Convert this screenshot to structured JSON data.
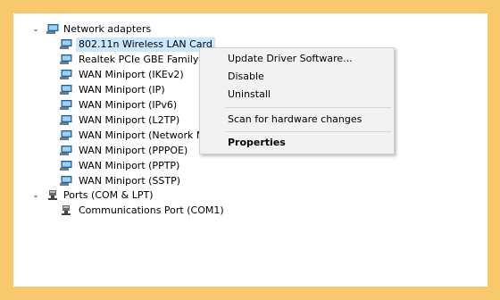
{
  "tree": {
    "category_network": {
      "label": "Network adapters",
      "icon": "network-adapter-icon",
      "expanded": true
    },
    "network_items": [
      {
        "label": "802.11n  Wireless  LAN  Card",
        "selected": true
      },
      {
        "label": "Realtek PCIe GBE Family Co"
      },
      {
        "label": "WAN Miniport (IKEv2)"
      },
      {
        "label": "WAN Miniport (IP)"
      },
      {
        "label": "WAN Miniport (IPv6)"
      },
      {
        "label": "WAN Miniport (L2TP)"
      },
      {
        "label": "WAN Miniport (Network M"
      },
      {
        "label": "WAN Miniport (PPPOE)"
      },
      {
        "label": "WAN Miniport (PPTP)"
      },
      {
        "label": "WAN Miniport (SSTP)"
      }
    ],
    "category_ports": {
      "label": "Ports (COM & LPT)",
      "icon": "port-icon",
      "expanded": true
    },
    "port_items": [
      {
        "label": "Communications Port (COM1)"
      }
    ]
  },
  "context_menu": {
    "items": [
      {
        "label": "Update Driver Software..."
      },
      {
        "label": "Disable"
      },
      {
        "label": "Uninstall"
      },
      {
        "label": "Scan for hardware changes"
      },
      {
        "label": "Properties",
        "bold": true
      }
    ]
  },
  "colors": {
    "frame": "#f8c86c",
    "selection": "#cce8ff",
    "menu_background": "#f2f2f2"
  }
}
